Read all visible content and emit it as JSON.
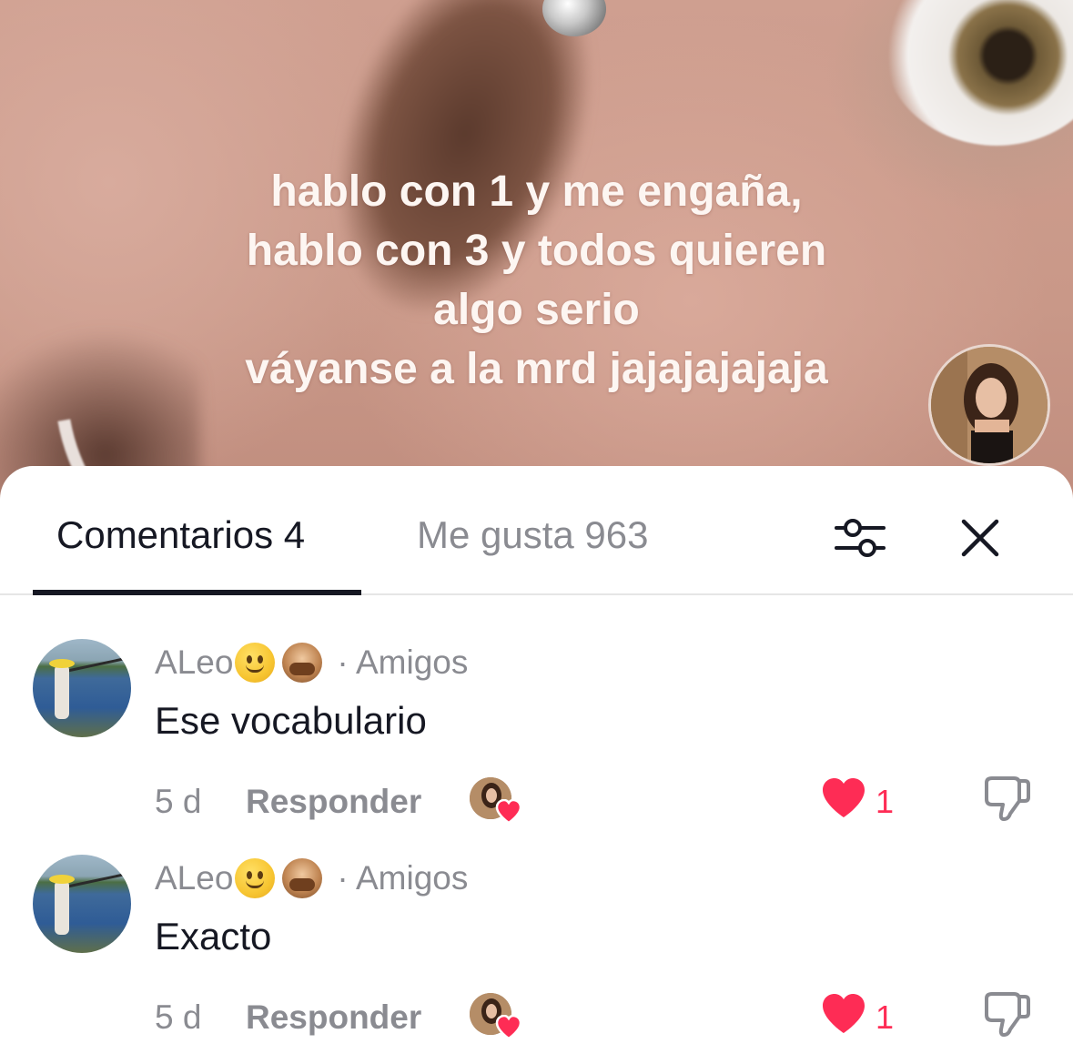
{
  "video": {
    "caption_lines": [
      "hablo con 1 y me engaña,",
      "hablo con 3 y todos quieren",
      "algo serio",
      "váyanse a la mrd jajajajajaja"
    ]
  },
  "sheet": {
    "tabs": [
      {
        "label": "Comentarios 4",
        "active": true
      },
      {
        "label": "Me gusta 963",
        "active": false
      }
    ],
    "filter_icon": "sliders-icon",
    "close_icon": "close-icon"
  },
  "comments": [
    {
      "user": "ALeo",
      "emojis": [
        "slightly-smiling-face",
        "see-no-evil-monkey"
      ],
      "relation": "· Amigos",
      "text": "Ese vocabulario",
      "age": "5 d",
      "reply_label": "Responder",
      "liked_by_creator": true,
      "likes": "1",
      "liked": true
    },
    {
      "user": "ALeo",
      "emojis": [
        "slightly-smiling-face",
        "see-no-evil-monkey"
      ],
      "relation": "· Amigos",
      "text": "Exacto",
      "age": "5 d",
      "reply_label": "Responder",
      "liked_by_creator": true,
      "likes": "1",
      "liked": true
    }
  ],
  "colors": {
    "accent_like": "#fe2c55",
    "text_primary": "#161823",
    "text_secondary": "#8a8b91"
  }
}
